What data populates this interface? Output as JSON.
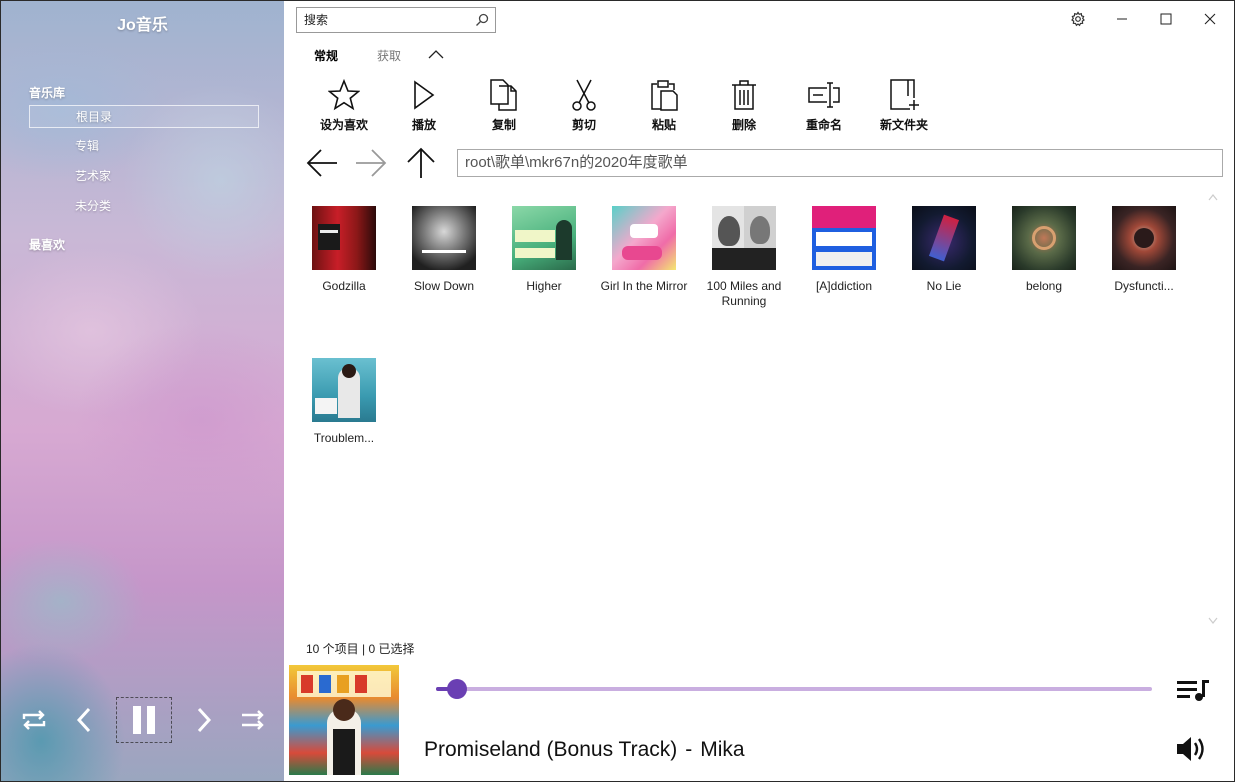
{
  "app": {
    "title": "Jo音乐"
  },
  "sidebar": {
    "library_heading": "音乐库",
    "items": [
      {
        "label": "根目录",
        "selected": true
      },
      {
        "label": "专辑",
        "selected": false
      },
      {
        "label": "艺术家",
        "selected": false
      },
      {
        "label": "未分类",
        "selected": false
      }
    ],
    "favorites_heading": "最喜欢"
  },
  "player_controls": {
    "icons": [
      "repeat-icon",
      "previous-icon",
      "pause-icon",
      "next-icon",
      "shuffle-icon"
    ]
  },
  "search": {
    "placeholder": "搜索",
    "value": ""
  },
  "ribbon": {
    "tabs": [
      {
        "label": "常规",
        "active": true
      },
      {
        "label": "获取",
        "active": false
      }
    ],
    "tools": [
      {
        "label": "设为喜欢",
        "icon": "star-icon"
      },
      {
        "label": "播放",
        "icon": "play-icon"
      },
      {
        "label": "复制",
        "icon": "copy-icon"
      },
      {
        "label": "剪切",
        "icon": "scissors-icon"
      },
      {
        "label": "粘贴",
        "icon": "paste-icon"
      },
      {
        "label": "删除",
        "icon": "delete-icon"
      },
      {
        "label": "重命名",
        "icon": "rename-icon"
      },
      {
        "label": "新文件夹",
        "icon": "new-folder-icon"
      }
    ]
  },
  "address": {
    "path": "root\\歌单\\mkr67n的2020年度歌单"
  },
  "items": [
    {
      "name": "Godzilla",
      "colors": [
        "#8f1a1a",
        "#d0202a",
        "#1a1a1a"
      ]
    },
    {
      "name": "Slow Down",
      "colors": [
        "#3a3a3a",
        "#d8d8d8",
        "#111111"
      ]
    },
    {
      "name": "Higher",
      "colors": [
        "#58c08c",
        "#e8f0a0",
        "#1a3a2a"
      ]
    },
    {
      "name": "Girl In the Mirror",
      "colors": [
        "#f2a0c8",
        "#40c8c0",
        "#f0e060"
      ]
    },
    {
      "name": "100 Miles and Running",
      "colors": [
        "#e8e8e8",
        "#707070",
        "#1a1a1a"
      ]
    },
    {
      "name": "[A]ddiction",
      "colors": [
        "#e0207a",
        "#1e5fe0",
        "#ffffff"
      ]
    },
    {
      "name": "No Lie",
      "colors": [
        "#101828",
        "#d02040",
        "#3050c0"
      ]
    },
    {
      "name": "belong",
      "colors": [
        "#3a5a3a",
        "#c07858",
        "#1a2a1a"
      ]
    },
    {
      "name": "Dysfuncti...",
      "colors": [
        "#3a2424",
        "#b05040",
        "#d0c0b0"
      ]
    },
    {
      "name": "Troublem...",
      "colors": [
        "#3a9ab0",
        "#e8e8e8",
        "#202020"
      ]
    }
  ],
  "status": {
    "text": "10 个项目 | 0 已选择"
  },
  "now_playing": {
    "title": "Promiseland (Bonus Track)",
    "separator": "-",
    "artist": "Mika",
    "progress": 0.03,
    "accent": "#6a3fb3",
    "track_color": "#c9aee0"
  }
}
